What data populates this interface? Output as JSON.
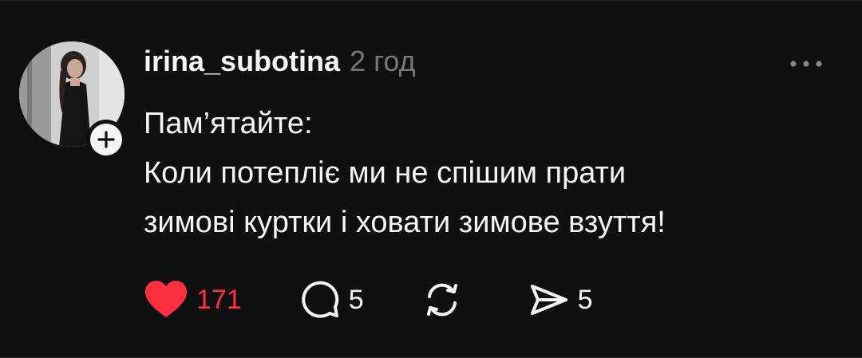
{
  "post": {
    "username": "irina_subotina",
    "timestamp": "2 год",
    "text_lines": [
      "Пам’ятайте:",
      "Коли потепліє ми не спішим прати",
      "зимові куртки і ховати зимове взуття!"
    ]
  },
  "actions": {
    "likes": "171",
    "replies": "5",
    "reposts": "",
    "shares": "5"
  },
  "colors": {
    "background": "#101010",
    "text": "#f3f5f7",
    "muted": "#777777",
    "like_red": "#ff3040"
  },
  "icons": {
    "like": "heart-icon",
    "reply": "comment-bubble-icon",
    "repost": "repost-icon",
    "share": "send-icon",
    "more": "more-horizontal-icon",
    "follow": "plus-icon"
  }
}
